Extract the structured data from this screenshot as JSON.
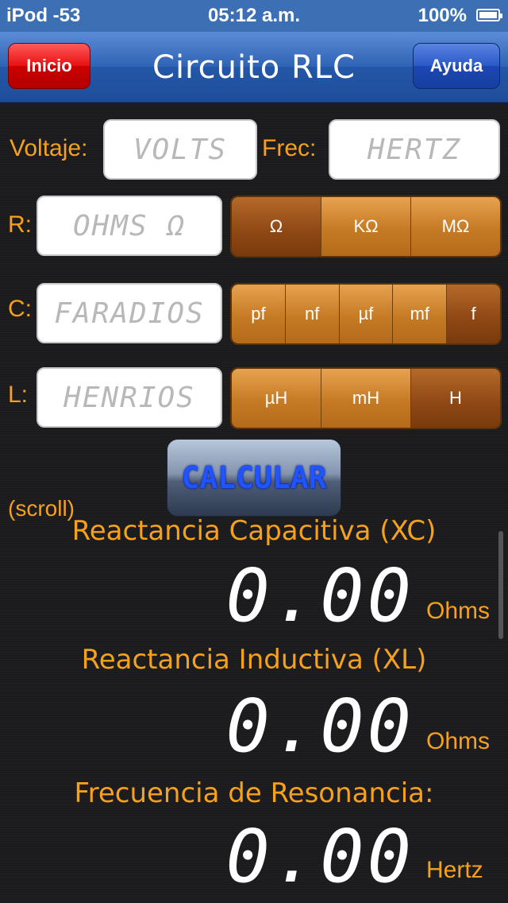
{
  "status": {
    "carrier": "iPod -53",
    "time": "05:12 a.m.",
    "battery": "100%"
  },
  "nav": {
    "title": "Circuito RLC",
    "left_button": "Inicio",
    "right_button": "Ayuda"
  },
  "inputs": {
    "voltage": {
      "label": "Voltaje:",
      "placeholder": "VOLTS"
    },
    "frequency": {
      "label": "Frec:",
      "placeholder": "HERTZ"
    },
    "r": {
      "label": "R:",
      "placeholder": "OHMS Ω",
      "units": [
        "Ω",
        "KΩ",
        "MΩ"
      ],
      "selected": "Ω"
    },
    "c": {
      "label": "C:",
      "placeholder": "FARADIOS",
      "units": [
        "pf",
        "nf",
        "µf",
        "mf",
        "f"
      ],
      "selected": "f"
    },
    "l": {
      "label": "L:",
      "placeholder": "HENRIOS",
      "units": [
        "µH",
        "mH",
        "H"
      ],
      "selected": "H"
    }
  },
  "calc_button": "CALCULAR",
  "scroll_label": "(scroll)",
  "results": [
    {
      "title": "Reactancia Capacitiva (XC)",
      "value": "0.00",
      "unit": "Ohms"
    },
    {
      "title": "Reactancia Inductiva (XL)",
      "value": "0.00",
      "unit": "Ohms"
    },
    {
      "title": "Frecuencia de Resonancia:",
      "value": "0.00",
      "unit": "Hertz"
    }
  ],
  "colors": {
    "accent": "#f6a11b",
    "nav": "#2f63b4",
    "segment": "#c67a24",
    "segment_selected": "#8e4714"
  }
}
